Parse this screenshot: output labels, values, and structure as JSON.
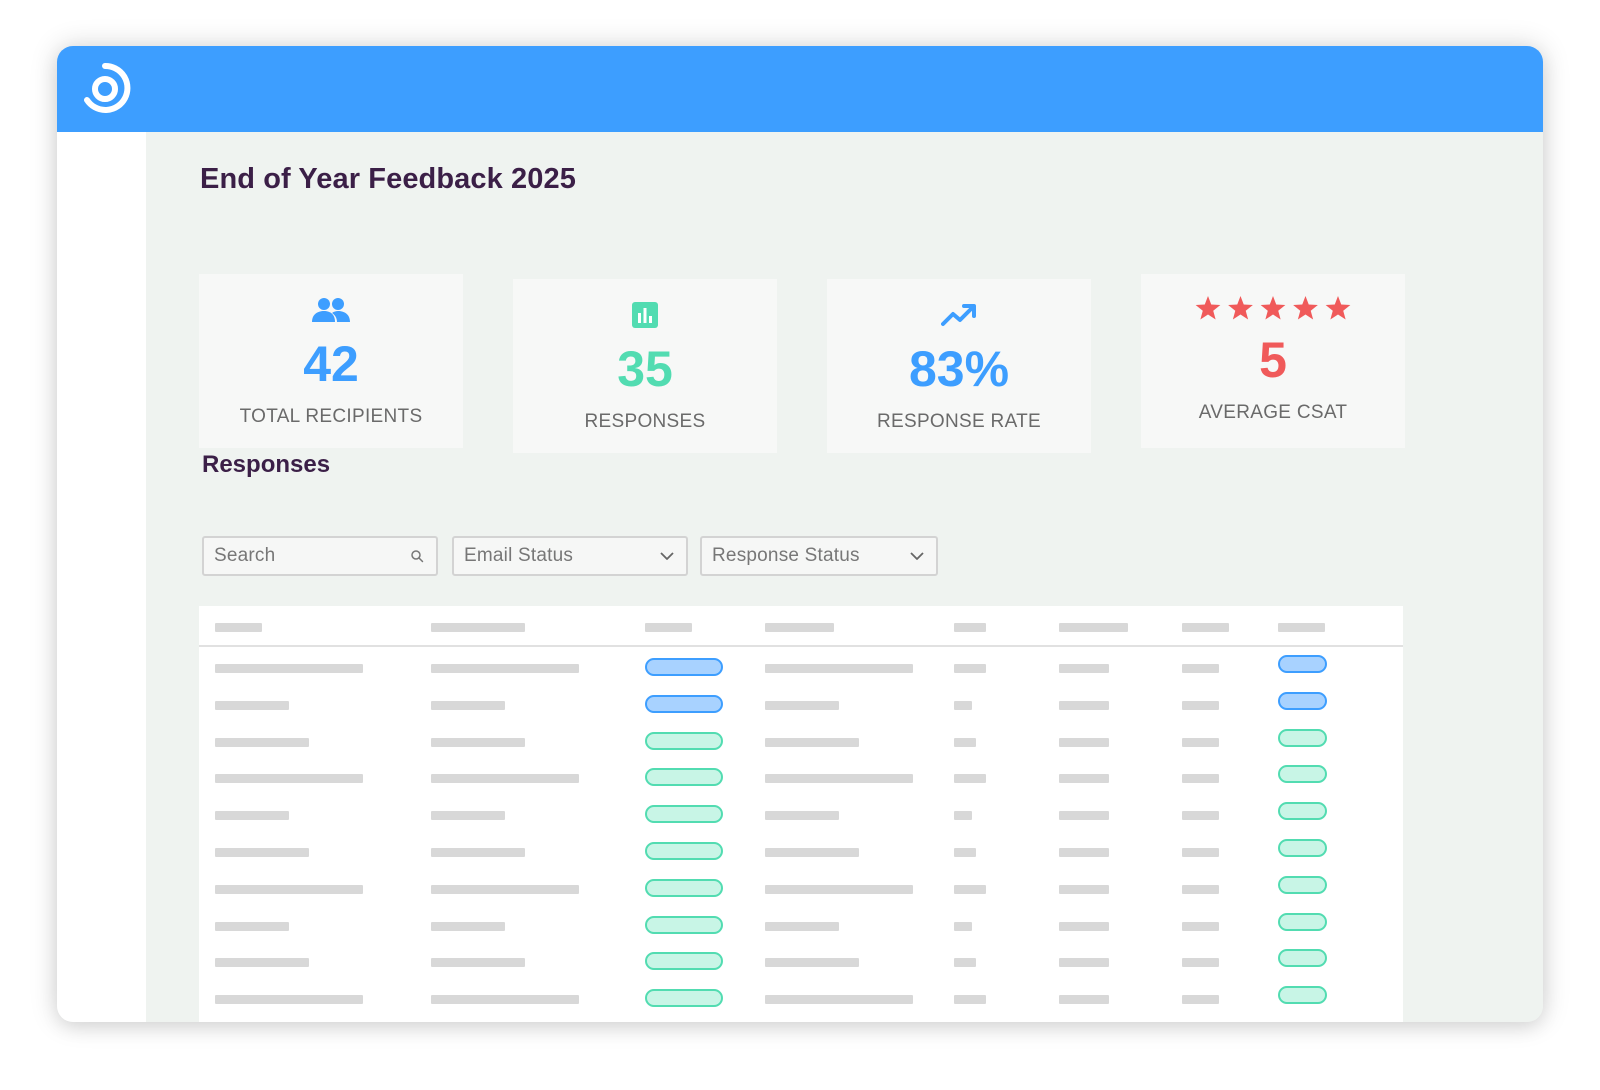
{
  "app": {
    "logo_icon": "brand-logo-icon",
    "brand_color": "#3d9eff",
    "page_title": "End of Year Feedback 2025"
  },
  "stats": [
    {
      "icon": "people-icon",
      "value": "42",
      "label": "TOTAL RECIPIENTS",
      "color": "#3d9eff"
    },
    {
      "icon": "bar-chart-icon",
      "value": "35",
      "label": "RESPONSES",
      "color": "#52dcb1"
    },
    {
      "icon": "trending-up-icon",
      "value": "83%",
      "label": "RESPONSE RATE",
      "color": "#3d9eff"
    },
    {
      "icon": "star-rating-icon",
      "value": "5",
      "label": "AVERAGE CSAT",
      "color": "#f05a5a",
      "stars": 5
    }
  ],
  "responses": {
    "title": "Responses",
    "search": {
      "placeholder": "Search",
      "icon": "search-icon"
    },
    "filters": [
      {
        "label": "Email Status",
        "icon": "chevron-down-icon"
      },
      {
        "label": "Response Status",
        "icon": "chevron-down-icon"
      }
    ],
    "table": {
      "columns": 8,
      "rows": [
        {
          "email_status": "blue",
          "response_status": "blue"
        },
        {
          "email_status": "blue",
          "response_status": "blue"
        },
        {
          "email_status": "green",
          "response_status": "green"
        },
        {
          "email_status": "green",
          "response_status": "green"
        },
        {
          "email_status": "green",
          "response_status": "green"
        },
        {
          "email_status": "green",
          "response_status": "green"
        },
        {
          "email_status": "green",
          "response_status": "green"
        },
        {
          "email_status": "green",
          "response_status": "green"
        },
        {
          "email_status": "green",
          "response_status": "green"
        },
        {
          "email_status": "green",
          "response_status": "green"
        },
        {
          "email_status": "green",
          "response_status": "green"
        }
      ]
    }
  }
}
